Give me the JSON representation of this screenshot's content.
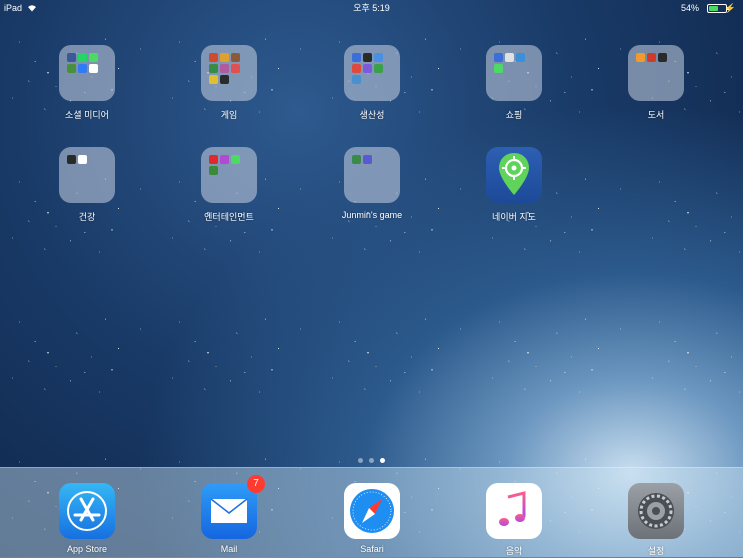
{
  "status_bar": {
    "carrier": "iPad",
    "time": "오후 5:19",
    "battery": "54%",
    "battery_level": 0.54
  },
  "home_apps": [
    {
      "label": "소셜 미디어",
      "type": "folder",
      "minis": [
        "#3b5998",
        "#25d366",
        "#4cd964",
        "#4a8f3c",
        "#2f7bf6",
        "#ffffff"
      ]
    },
    {
      "label": "게임",
      "type": "folder",
      "minis": [
        "#d04a2f",
        "#e0a030",
        "#8a5a3a",
        "#3a8a4a",
        "#b05aa0",
        "#e05050",
        "#e0c030",
        "#2a2a2a"
      ]
    },
    {
      "label": "생산성",
      "type": "folder",
      "minis": [
        "#3a6fd8",
        "#2a2a2a",
        "#4a90e2",
        "#e04a3a",
        "#7b5cd8",
        "#3aa04a",
        "#4a8fd0"
      ]
    },
    {
      "label": "쇼핑",
      "type": "folder",
      "minis": [
        "#3a6fd8",
        "#e0e0e0",
        "#3a8fd8",
        "#4cd964"
      ]
    },
    {
      "label": "도서",
      "type": "folder",
      "minis": [
        "#f09a30",
        "#d03a2a",
        "#2a2a2a"
      ]
    },
    {
      "label": "건강",
      "type": "folder",
      "minis": [
        "#2a2a2a",
        "#ffffff"
      ]
    },
    {
      "label": "엔터테인먼트",
      "type": "folder",
      "minis": [
        "#e02a2a",
        "#b04ad0",
        "#4cd964",
        "#3a8a3a"
      ]
    },
    {
      "label": "Junmin's game",
      "type": "folder",
      "minis": [
        "#3a8a4a",
        "#5a5ad0"
      ]
    },
    {
      "label": "네이버 지도",
      "type": "app"
    }
  ],
  "dock": [
    {
      "label": "App Store",
      "icon": "app-store-icon"
    },
    {
      "label": "Mail",
      "icon": "mail-icon",
      "badge": "7"
    },
    {
      "label": "Safari",
      "icon": "safari-icon"
    },
    {
      "label": "음악",
      "icon": "music-icon"
    },
    {
      "label": "설정",
      "icon": "settings-icon"
    }
  ],
  "page_indicator": {
    "pages": 3,
    "current": 3,
    "spotlight": true
  }
}
